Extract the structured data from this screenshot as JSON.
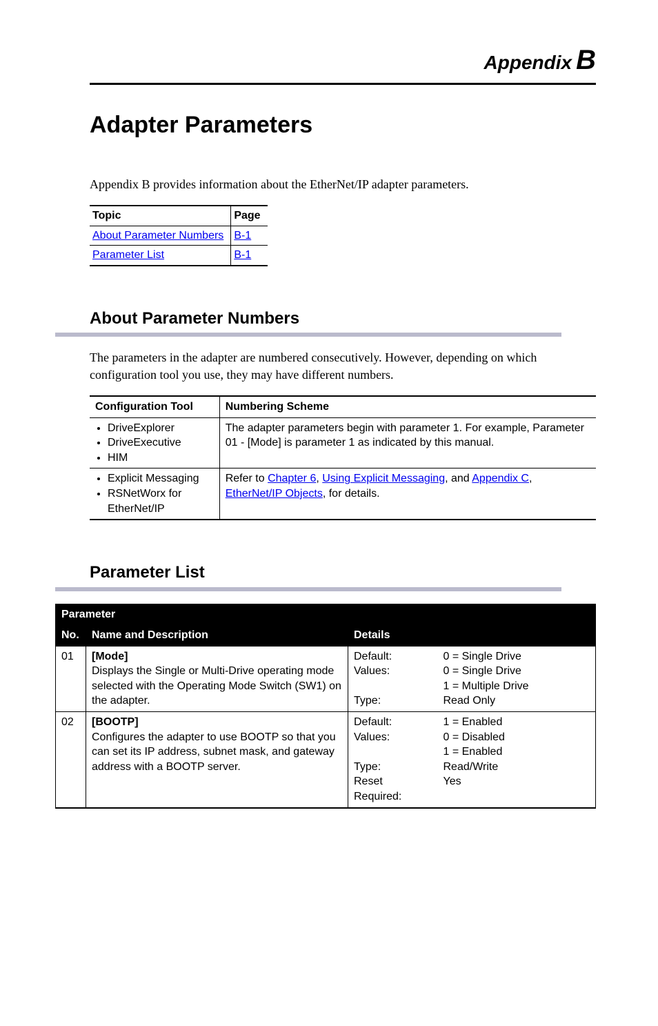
{
  "appendixHeader": {
    "label": "Appendix",
    "letter": "B"
  },
  "pageTitle": "Adapter Parameters",
  "lead": "Appendix B provides information about the EtherNet/IP adapter parameters.",
  "topicTable": {
    "headers": [
      "Topic",
      "Page"
    ],
    "rows": [
      {
        "topic": "About Parameter Numbers",
        "page": "B-1"
      },
      {
        "topic": "Parameter List",
        "page": "B-1"
      }
    ]
  },
  "sections": {
    "about": {
      "heading": "About Parameter Numbers",
      "body": "The parameters in the adapter are numbered consecutively. However, depending on which configuration tool you use, they may have different numbers.",
      "table": {
        "headers": [
          "Configuration Tool",
          "Numbering Scheme"
        ],
        "rows": [
          {
            "tools": [
              "DriveExplorer",
              "DriveExecutive",
              "HIM"
            ],
            "scheme_plain": "The adapter parameters begin with parameter 1. For example, Parameter 01 - [Mode] is parameter 1 as indicated by this manual."
          },
          {
            "tools": [
              "Explicit Messaging",
              "RSNetWorx for EtherNet/IP"
            ],
            "scheme_pre": "Refer to ",
            "scheme_link1": "Chapter 6",
            "scheme_mid1": ", ",
            "scheme_link2": "Using Explicit Messaging",
            "scheme_mid2": ", and ",
            "scheme_link3": "Appendix C",
            "scheme_mid3": ", ",
            "scheme_link4": "EtherNet/IP Objects",
            "scheme_post": ", for details."
          }
        ]
      }
    },
    "paramList": {
      "heading": "Parameter List",
      "table": {
        "groupHeader": "Parameter",
        "subHeaders": {
          "no": "No.",
          "name": "Name and Description",
          "details": "Details"
        },
        "rows": [
          {
            "no": "01",
            "name": "[Mode]",
            "desc": "Displays the Single or Multi-Drive operating mode selected with the Operating Mode Switch (SW1) on the adapter.",
            "details": [
              {
                "k": "Default:",
                "v": "0 = Single Drive"
              },
              {
                "k": "Values:",
                "v": "0 = Single Drive"
              },
              {
                "k": "",
                "v": "1 = Multiple Drive"
              },
              {
                "k": "Type:",
                "v": "Read Only"
              }
            ]
          },
          {
            "no": "02",
            "name": "[BOOTP]",
            "desc": "Configures the adapter to use BOOTP so that you can set its IP address, subnet mask, and gateway address with a BOOTP server.",
            "details": [
              {
                "k": "Default:",
                "v": "1 = Enabled"
              },
              {
                "k": "Values:",
                "v": "0 = Disabled"
              },
              {
                "k": "",
                "v": "1 = Enabled"
              },
              {
                "k": "Type:",
                "v": "Read/Write"
              },
              {
                "k": "Reset Required:",
                "v": "Yes"
              }
            ]
          }
        ]
      }
    }
  }
}
